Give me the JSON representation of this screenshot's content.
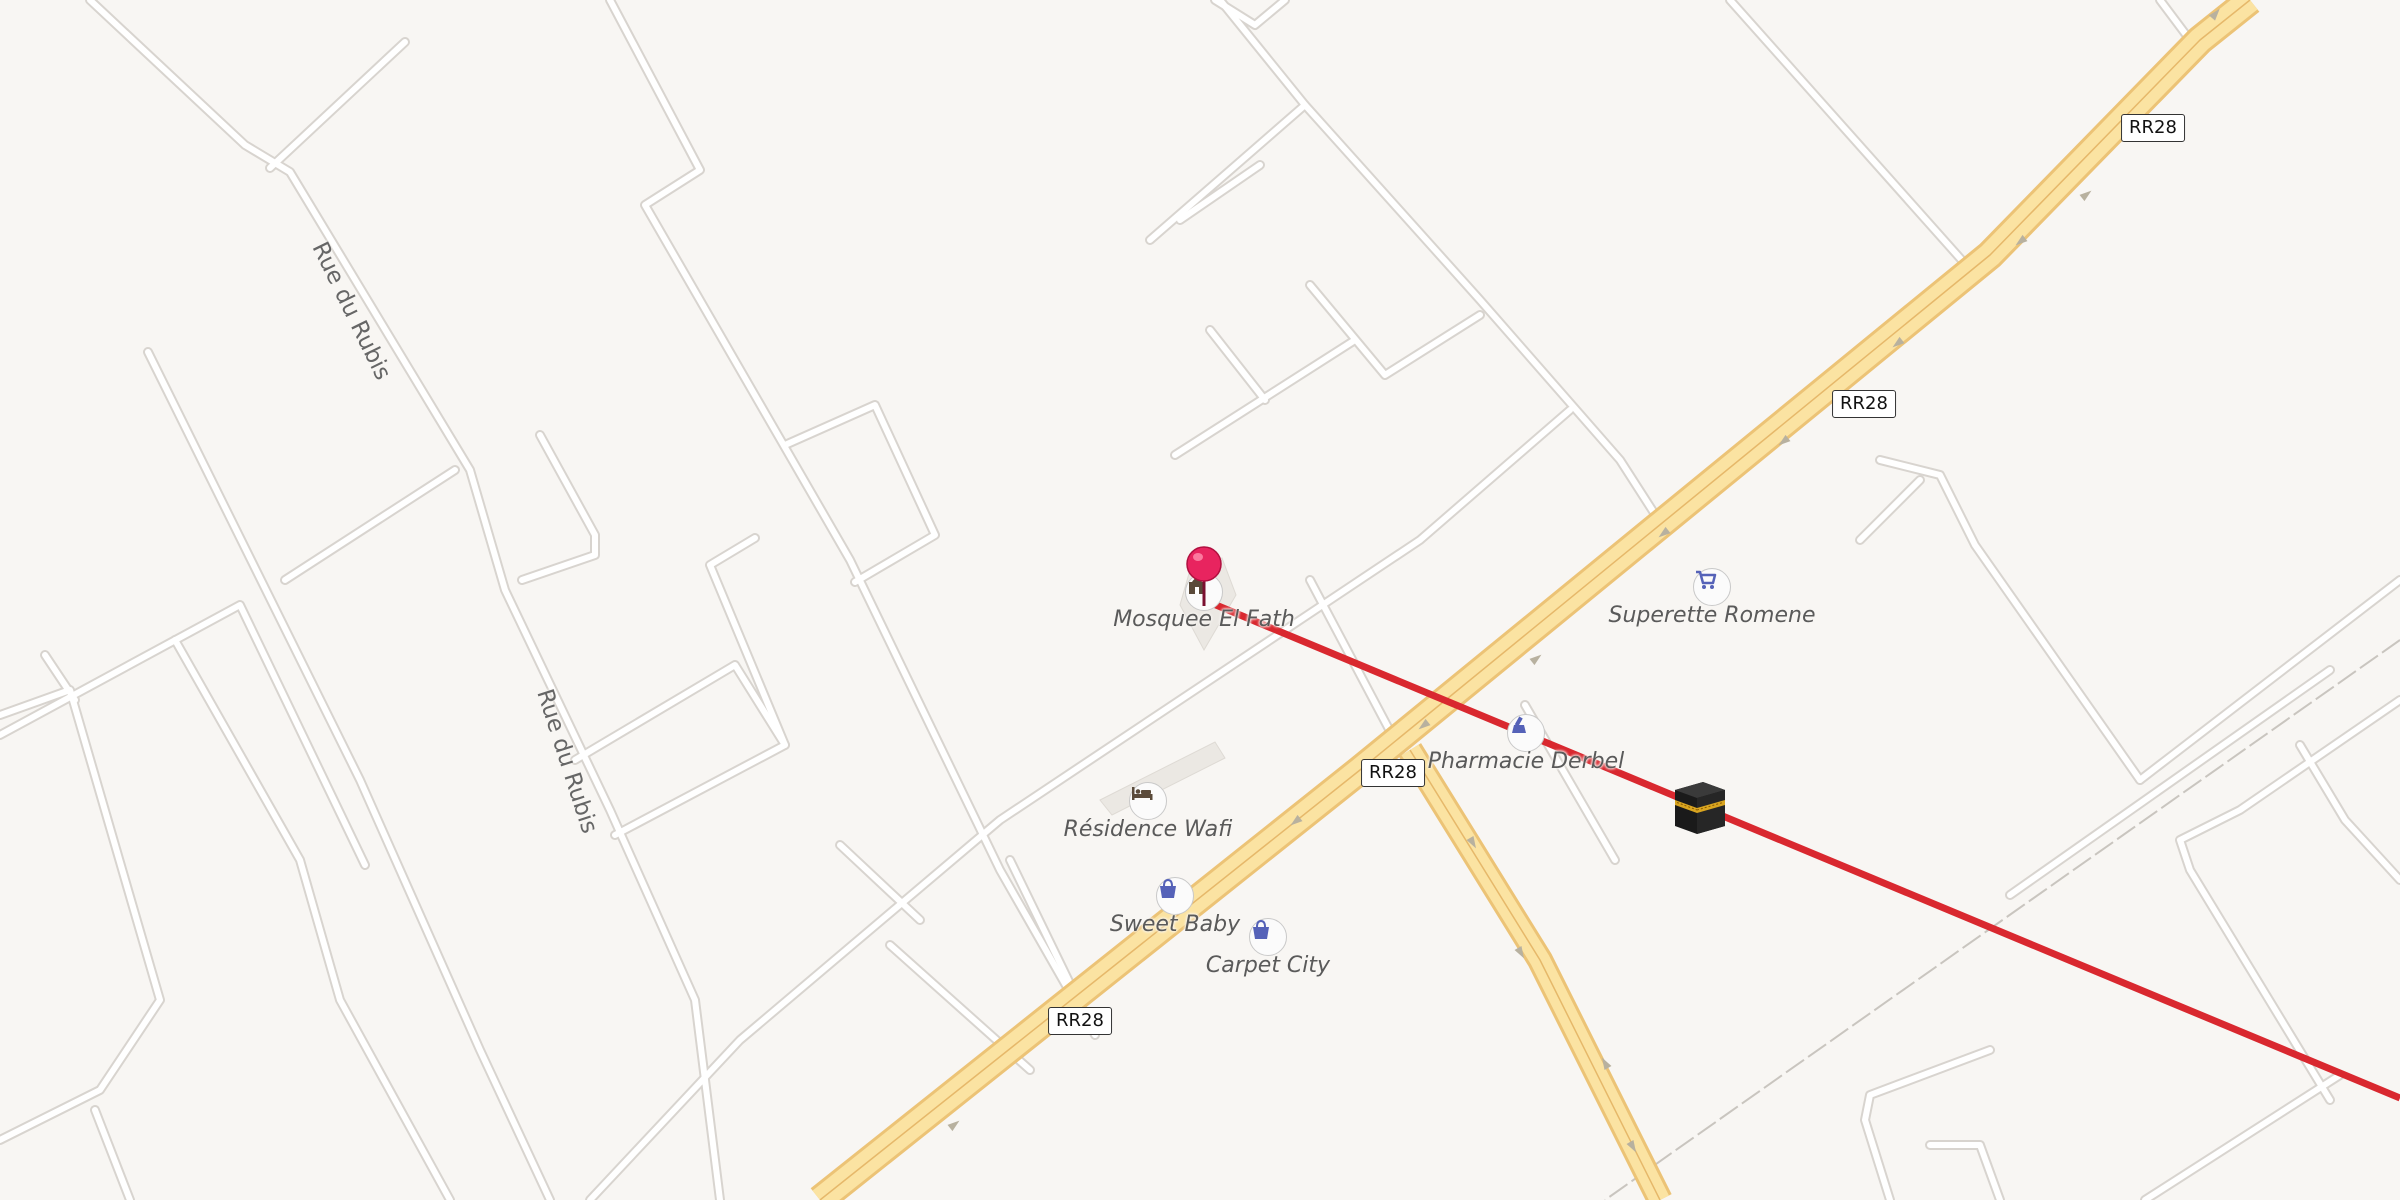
{
  "map": {
    "streets": [
      {
        "id": "rue-du-rubis-1",
        "name": "Rue du Rubis"
      },
      {
        "id": "rue-du-rubis-2",
        "name": "Rue du Rubis"
      }
    ],
    "route_shields": [
      {
        "id": "rr28-a",
        "label": "RR28"
      },
      {
        "id": "rr28-b",
        "label": "RR28"
      },
      {
        "id": "rr28-c",
        "label": "RR28"
      },
      {
        "id": "rr28-d",
        "label": "RR28"
      }
    ],
    "pois": [
      {
        "id": "mosquee",
        "name": "Mosquee El Fath",
        "icon": "mosque-icon"
      },
      {
        "id": "superette",
        "name": "Superette Romene",
        "icon": "shopping-cart-icon"
      },
      {
        "id": "pharmacie",
        "name": "Pharmacie Derbel",
        "icon": "pharmacy-icon"
      },
      {
        "id": "residence",
        "name": "Résidence Wafi",
        "icon": "bed-icon"
      },
      {
        "id": "sweet-baby",
        "name": "Sweet Baby",
        "icon": "shopping-bag-icon"
      },
      {
        "id": "carpet-city",
        "name": "Carpet City",
        "icon": "shopping-bag-icon"
      }
    ],
    "markers": {
      "location_pin": "location-pin-icon",
      "qibla_marker": "kaaba-icon"
    },
    "colors": {
      "background": "#f8f6f3",
      "minor_road": "#ffffff",
      "minor_road_casing": "#d8d4cf",
      "highway_fill": "#fbe3a2",
      "highway_casing": "#ecc376",
      "direction_line": "#d9282f",
      "pin": "#e8245f",
      "poi_icon": "#5562b8"
    }
  }
}
